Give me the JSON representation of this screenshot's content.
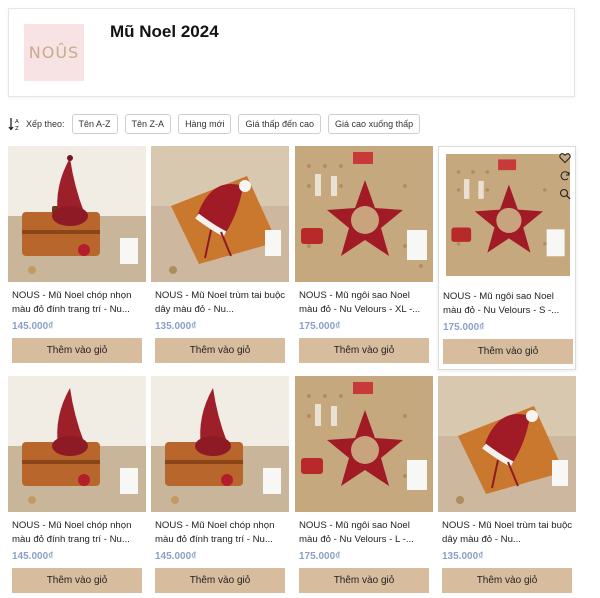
{
  "header": {
    "logo_text": "NOÛS",
    "title": "Mũ Noel 2024"
  },
  "sort": {
    "label": "Xếp theo:",
    "options": [
      "Tên A-Z",
      "Tên Z-A",
      "Hàng mới",
      "Giá thấp đến cao",
      "Giá cao xuống thấp"
    ]
  },
  "products": [
    {
      "name": "NOUS - Mũ Noel chóp nhọn màu đỏ đính trang trí - Nu...",
      "price": "145.000₫",
      "add_label": "Thêm vào giỏ",
      "image": "gnome-hat-on-suitcase"
    },
    {
      "name": "NOUS - Mũ Noel trùm tai buộc dây màu đỏ - Nu...",
      "price": "135.000₫",
      "add_label": "Thêm vào giỏ",
      "image": "santa-hat-on-suitcase"
    },
    {
      "name": "NOUS - Mũ ngôi sao Noel màu đỏ - Nu Velours - XL -...",
      "price": "175.000₫",
      "add_label": "Thêm vào giỏ",
      "image": "star-hat-on-pegboard"
    },
    {
      "name": "NOUS - Mũ ngôi sao Noel màu đỏ - Nu Velours - S -...",
      "price": "175.000₫",
      "add_label": "Thêm vào giỏ",
      "image": "star-hat-on-pegboard"
    },
    {
      "name": "NOUS - Mũ Noel chóp nhọn màu đỏ đính trang trí - Nu...",
      "price": "145.000₫",
      "add_label": "Thêm vào giỏ",
      "image": "gnome-hat-on-suitcase"
    },
    {
      "name": "NOUS - Mũ Noel chóp nhọn màu đỏ đính trang trí - Nu...",
      "price": "145.000₫",
      "add_label": "Thêm vào giỏ",
      "image": "gnome-hat-on-suitcase"
    },
    {
      "name": "NOUS - Mũ ngôi sao Noel màu đỏ - Nu Velours - L -...",
      "price": "175.000₫",
      "add_label": "Thêm vào giỏ",
      "image": "star-hat-on-pegboard"
    },
    {
      "name": "NOUS - Mũ Noel trùm tai buộc dây màu đỏ - Nu...",
      "price": "135.000₫",
      "add_label": "Thêm vào giỏ",
      "image": "santa-hat-on-suitcase"
    }
  ],
  "colors": {
    "accent_button": "#d8bc9e",
    "price": "#8aa0c9",
    "logo_bg": "#f8e3e4"
  },
  "hover_actions": [
    "heart-icon",
    "refresh-icon",
    "search-icon"
  ]
}
